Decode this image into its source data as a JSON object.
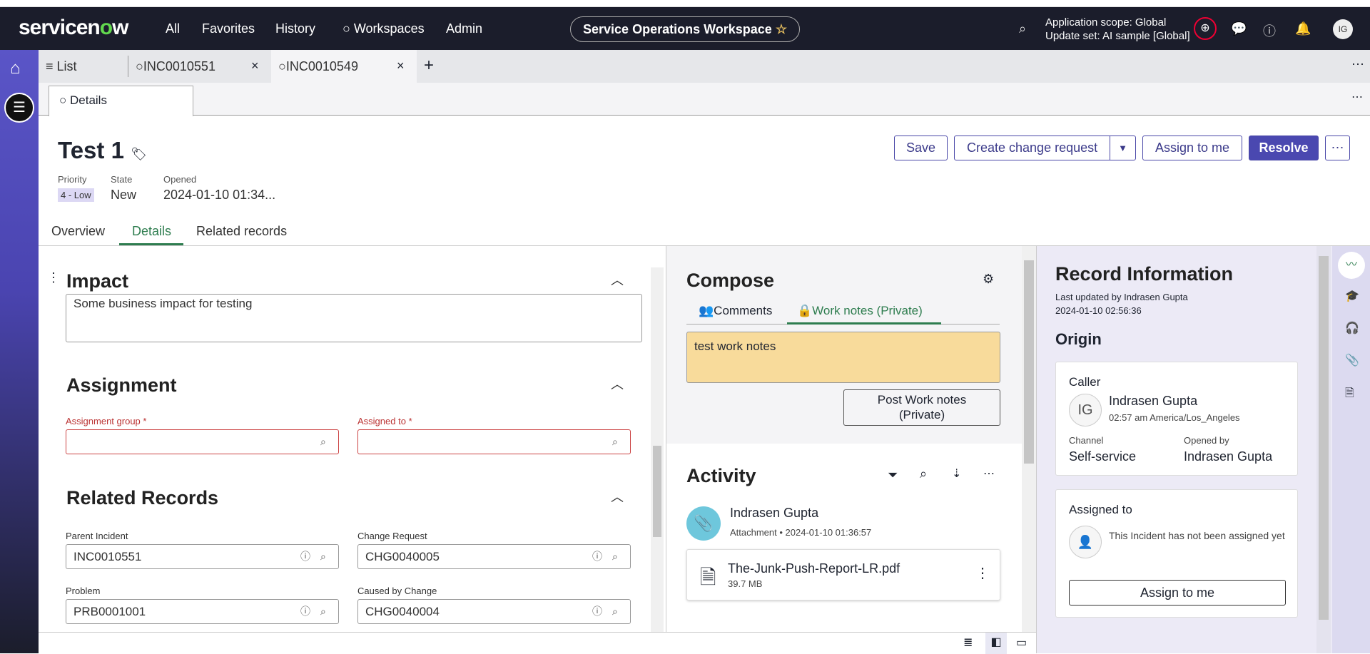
{
  "nav": {
    "logo": "servicenow",
    "items": [
      "All",
      "Favorites",
      "History",
      "Workspaces",
      "Admin"
    ],
    "workspace": "Service Operations Workspace",
    "scope_line1": "Application scope: Global",
    "scope_line2": "Update set: AI sample [Global]",
    "avatar": "IG"
  },
  "tabs": {
    "list": "List",
    "tab1": "INC0010551",
    "tab2": "INC0010549",
    "subtab": "Details"
  },
  "record": {
    "title": "Test 1",
    "priority_label": "Priority",
    "priority": "4 - Low",
    "state_label": "State",
    "state": "New",
    "opened_label": "Opened",
    "opened": "2024-01-10 01:34..."
  },
  "actions": {
    "save": "Save",
    "create_change": "Create change request",
    "assign": "Assign to me",
    "resolve": "Resolve"
  },
  "page_tabs": [
    "Overview",
    "Details",
    "Related records"
  ],
  "impact": {
    "title": "Impact",
    "text": "Some business impact for testing"
  },
  "assignment": {
    "title": "Assignment",
    "group_label": "Assignment group",
    "assigned_label": "Assigned to",
    "required": "*"
  },
  "related": {
    "title": "Related Records",
    "parent_label": "Parent Incident",
    "parent": "INC0010551",
    "change_label": "Change Request",
    "change": "CHG0040005",
    "problem_label": "Problem",
    "problem": "PRB0001001",
    "caused_label": "Caused by Change",
    "caused": "CHG0040004"
  },
  "compose": {
    "title": "Compose",
    "tab_comments": "Comments",
    "tab_worknotes": "Work notes (Private)",
    "text": "test work notes",
    "post": "Post Work notes (Private)",
    "worknotes_bg": "#f8db9b"
  },
  "activity": {
    "title": "Activity",
    "author": "Indrasen Gupta",
    "type": "Attachment",
    "time": "2024-01-10 01:36:57",
    "file": "The-Junk-Push-Report-LR.pdf",
    "size": "39.7 MB"
  },
  "info": {
    "title": "Record Information",
    "updated": "Last updated by Indrasen Gupta",
    "updated_time": "2024-01-10 02:56:36",
    "origin": "Origin",
    "caller_label": "Caller",
    "caller_initials": "IG",
    "caller": "Indrasen Gupta",
    "caller_time": "02:57 am America/Los_Angeles",
    "channel_label": "Channel",
    "channel": "Self-service",
    "opened_by_label": "Opened by",
    "opened_by": "Indrasen Gupta",
    "assigned_label": "Assigned to",
    "not_assigned": "This Incident has not been assigned yet",
    "assign_btn": "Assign to me"
  },
  "colors": {
    "accent": "#4a48b0",
    "nav_bg": "#1b1d2b",
    "active_tab": "#2e7d4f"
  }
}
